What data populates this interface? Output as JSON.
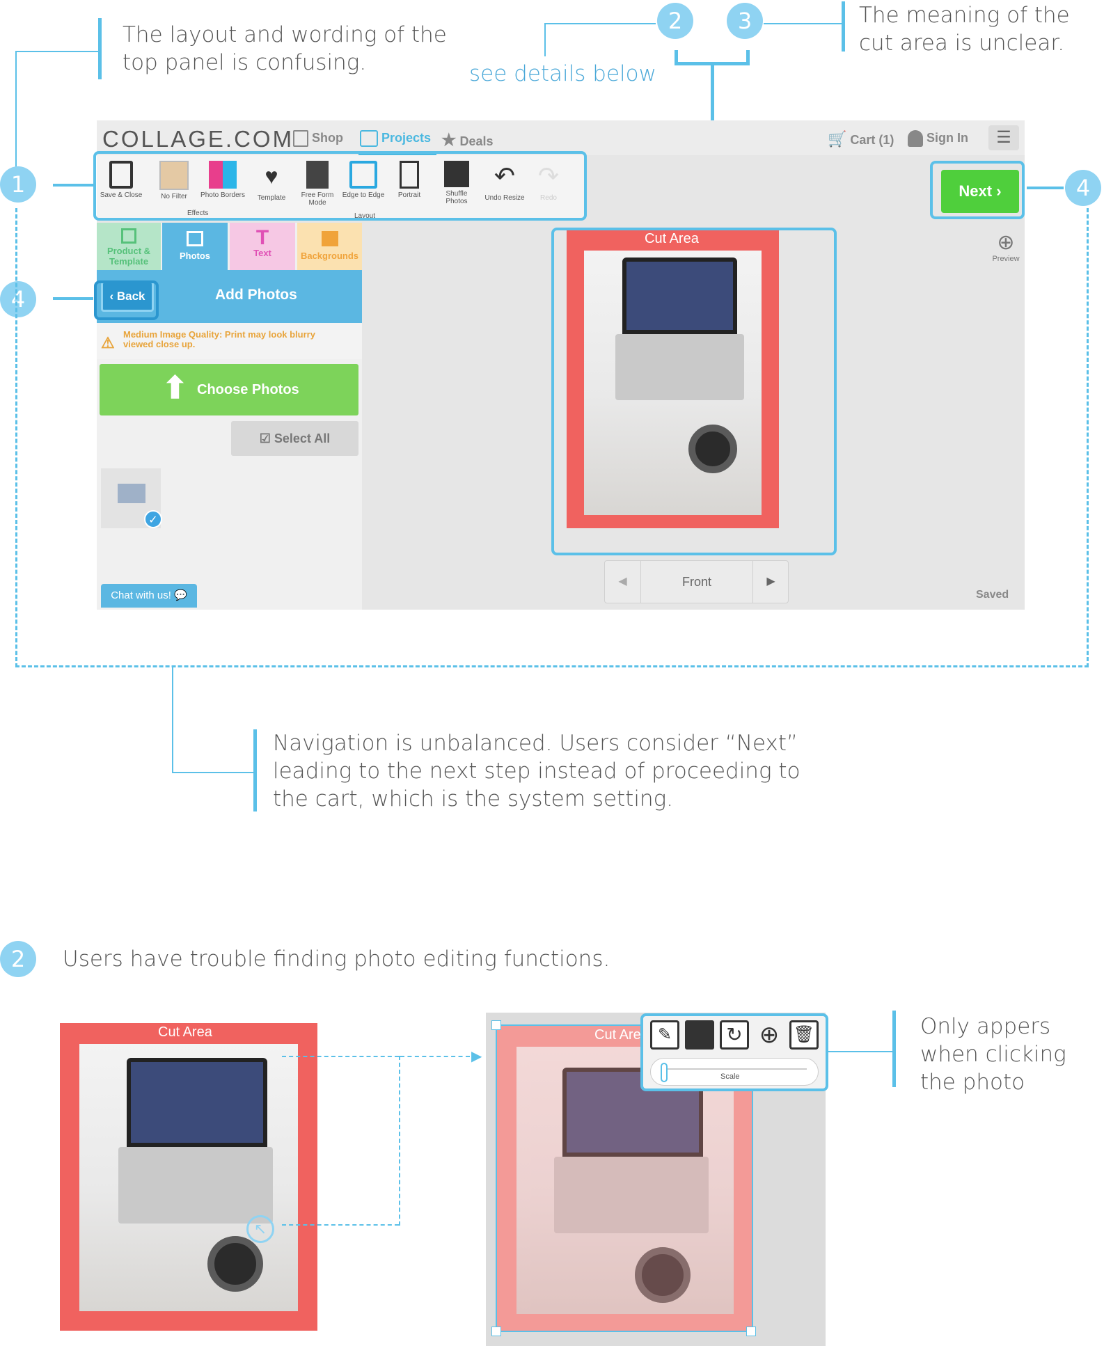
{
  "annotations": {
    "top_panel": "The layout and wording of the top panel is confusing.",
    "see_details": "see details below",
    "cut_area": "The meaning of the cut area is unclear.",
    "navigation": "Navigation is unbalanced. Users consider “Next” leading to the next step instead of proceeding to the cart, which is the system setting.",
    "editing": "Users have trouble finding photo editing functions.",
    "only_appears": "Only appers when clicking the photo"
  },
  "markers": {
    "m1": "1",
    "m2": "2",
    "m3": "3",
    "m4": "4",
    "m2b": "2"
  },
  "app": {
    "logo": "COLLAGE.COM",
    "nav": {
      "shop": "Shop",
      "projects": "Projects",
      "deals": "Deals"
    },
    "cart": "Cart (1)",
    "sign_in": "Sign In",
    "toolbar": {
      "save_close": "Save & Close",
      "no_filter": "No Filter",
      "photo_borders": "Photo Borders",
      "effects": "Effects",
      "template": "Template",
      "free_form": "Free Form Mode",
      "edge_to_edge": "Edge to Edge",
      "layout": "Layout",
      "portrait": "Portrait",
      "shuffle": "Shuffle Photos",
      "undo": "Undo Resize",
      "redo": "Redo"
    },
    "next": "Next",
    "preview": "Preview",
    "tabs": {
      "product": "Product & Template",
      "photos": "Photos",
      "text": "Text",
      "backgrounds": "Backgrounds"
    },
    "back": "Back",
    "add_photos": "Add Photos",
    "warning": "Medium Image Quality: Print may look blurry viewed close up.",
    "choose_photos": "Choose Photos",
    "select_all": "Select All",
    "chat": "Chat with us!",
    "cut_area": "Cut Area",
    "front": "Front",
    "saved": "Saved"
  },
  "detail": {
    "cut_area_left": "Cut Area",
    "cut_area_right": "Cut Are",
    "scale": "Scale"
  },
  "colors": {
    "accent": "#5bc0e8",
    "next_green": "#4fcf3c",
    "cut_red": "#f0625f"
  }
}
